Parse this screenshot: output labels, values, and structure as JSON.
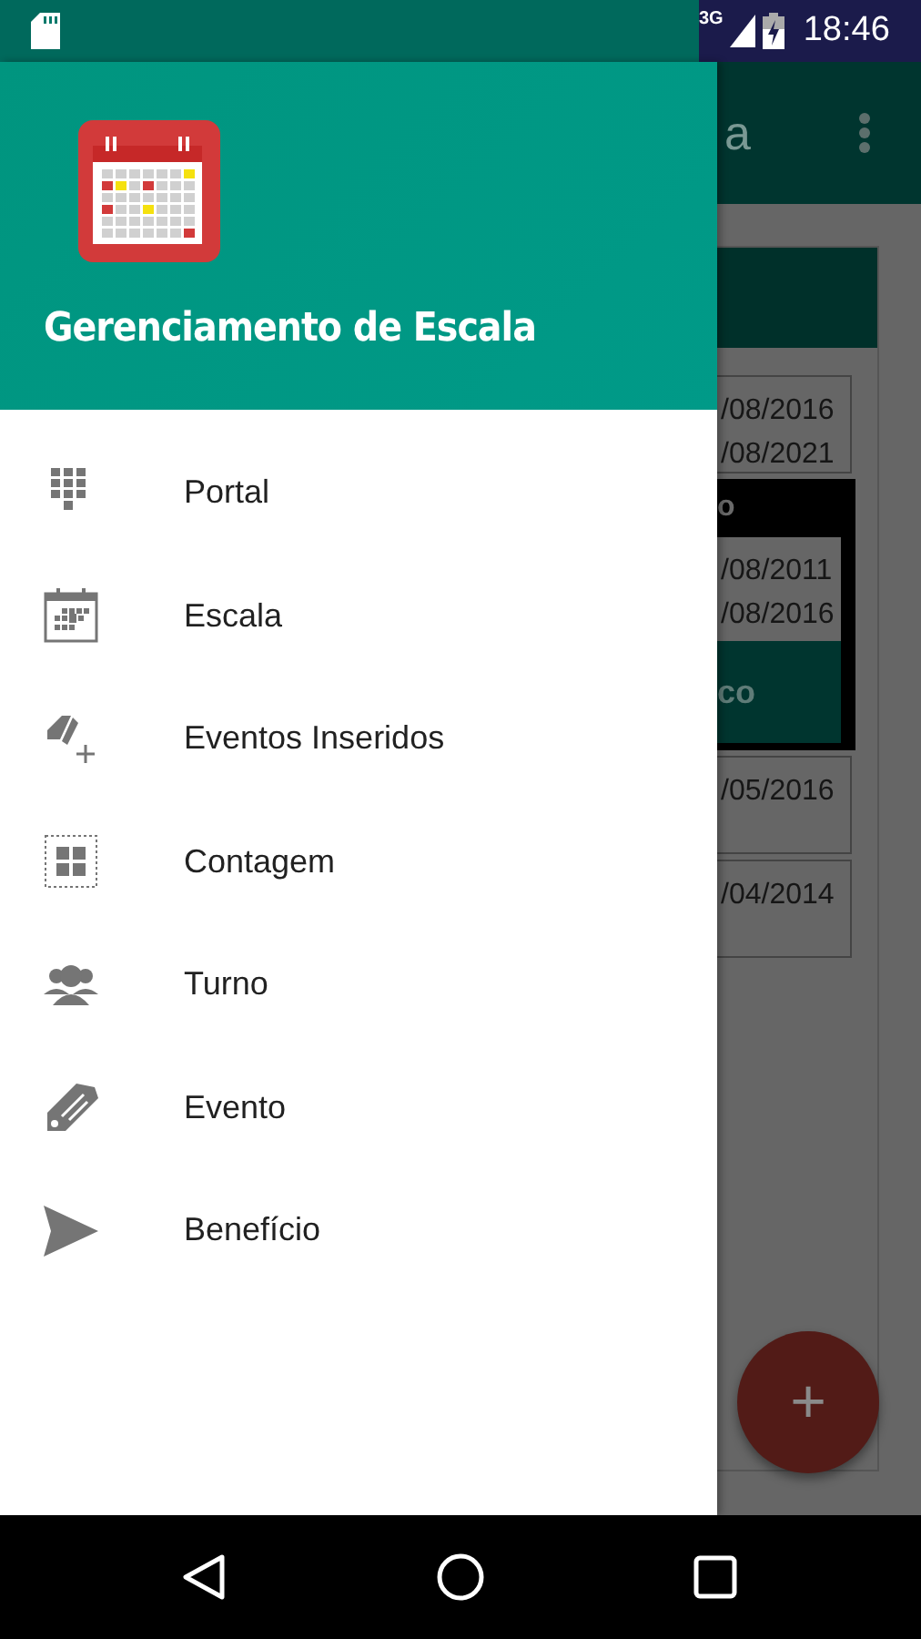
{
  "status_bar": {
    "network": "3G",
    "time": "18:46"
  },
  "drawer": {
    "title": "Gerenciamento de Escala",
    "items": [
      {
        "label": "Portal",
        "kind": "dialpad",
        "selected": false
      },
      {
        "label": "Escala",
        "kind": "calendar",
        "selected": false
      },
      {
        "label": "Eventos Inseridos",
        "kind": "tagplus",
        "selected": false
      },
      {
        "label": "Contagem",
        "kind": "grid",
        "selected": false
      },
      {
        "label": "Turno",
        "kind": "people",
        "selected": false
      },
      {
        "label": "Evento",
        "kind": "tag",
        "selected": false
      },
      {
        "label": "Benefício",
        "kind": "send",
        "selected": false
      }
    ]
  },
  "background": {
    "app_bar_title": "a",
    "entries": [
      {
        "kind": "dates",
        "lines": [
          "/08/2016",
          "/08/2021"
        ]
      },
      {
        "kind": "expanded",
        "heading": "o",
        "lines": [
          "/08/2011",
          "/08/2016"
        ],
        "action": "co"
      },
      {
        "kind": "dates",
        "lines": [
          "/05/2016"
        ]
      },
      {
        "kind": "dates",
        "lines": [
          "/04/2014"
        ]
      }
    ],
    "fab": "+"
  }
}
